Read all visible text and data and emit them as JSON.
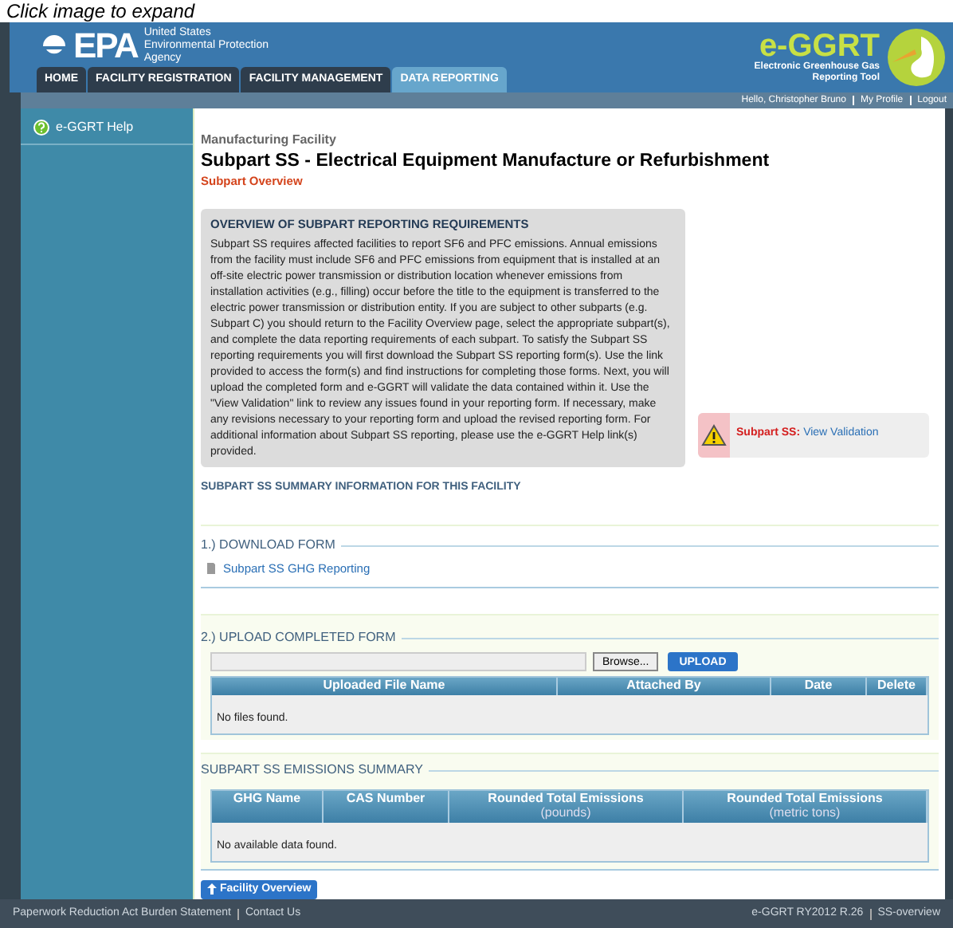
{
  "caption": "Click image to expand",
  "header": {
    "agency_mark": "EPA",
    "agency_name": [
      "United States",
      "Environmental Protection",
      "Agency"
    ],
    "tool_logo": "e-GGRT",
    "tool_name": [
      "Electronic Greenhouse Gas",
      "Reporting Tool"
    ]
  },
  "tabs": [
    {
      "label": "HOME",
      "selected": false
    },
    {
      "label": "FACILITY REGISTRATION",
      "selected": false
    },
    {
      "label": "FACILITY MANAGEMENT",
      "selected": false
    },
    {
      "label": "DATA REPORTING",
      "selected": true
    }
  ],
  "user_links": [
    "Hello, Christopher Bruno",
    "My Profile",
    "Logout"
  ],
  "sidebar": {
    "items": [
      {
        "label": "e-GGRT Help"
      }
    ]
  },
  "page": {
    "facility": "Manufacturing Facility",
    "title": "Subpart SS - Electrical Equipment Manufacture or Refurbishment",
    "subtitle": "Subpart Overview"
  },
  "overview": {
    "heading": "OVERVIEW OF SUBPART REPORTING REQUIREMENTS",
    "text": "Subpart SS requires affected facilities to report SF6 and PFC emissions. Annual emissions from the facility must include SF6 and PFC emissions from equipment that is installed at an off-site electric power transmission or distribution location whenever emissions from installation activities (e.g., filling) occur before the title to the equipment is transferred to the electric power transmission or distribution entity. If you are subject to other subparts (e.g. Subpart C) you should return to the Facility Overview page, select the appropriate subpart(s), and complete the data reporting requirements of each subpart. To satisfy the Subpart SS reporting requirements you will first download the Subpart SS reporting form(s). Use the link provided to access the form(s) and find instructions for completing those forms. Next, you will upload the completed form and e-GGRT will validate the data contained within it. Use the \"View Validation\" link to review any issues found in your reporting form. If necessary, make any revisions necessary to your reporting form and upload the revised reporting form. For additional information about Subpart SS reporting, please use the e-GGRT Help link(s) provided."
  },
  "validation": {
    "label": "Subpart SS:",
    "link": "View Validation"
  },
  "summary_heading": "SUBPART SS SUMMARY INFORMATION FOR THIS FACILITY",
  "download": {
    "legend": "1.) DOWNLOAD FORM",
    "link": "Subpart SS GHG Reporting"
  },
  "upload": {
    "legend": "2.) UPLOAD COMPLETED FORM",
    "browse": "Browse...",
    "button": "UPLOAD",
    "columns": [
      "Uploaded File Name",
      "Attached By",
      "Date",
      "Delete"
    ],
    "empty": "No files found."
  },
  "emissions": {
    "legend": "SUBPART SS EMISSIONS SUMMARY",
    "columns": [
      {
        "label": "GHG Name"
      },
      {
        "label": "CAS Number"
      },
      {
        "label": "Rounded Total Emissions",
        "unit": "(pounds)"
      },
      {
        "label": "Rounded Total Emissions",
        "unit": "(metric tons)"
      }
    ],
    "empty": "No available data found."
  },
  "back_button": "Facility Overview",
  "footer": {
    "left": [
      "Paperwork Reduction Act Burden Statement",
      "Contact Us"
    ],
    "right": [
      "e-GGRT RY2012 R.26",
      "SS-overview"
    ]
  }
}
